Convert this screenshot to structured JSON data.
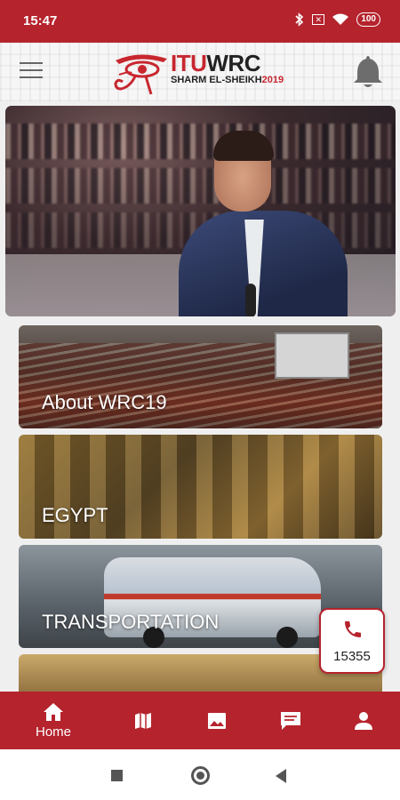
{
  "status_bar": {
    "time": "15:47",
    "battery": "100",
    "icons": [
      "bluetooth-icon",
      "nfc-icon",
      "wifi-icon",
      "battery-icon"
    ]
  },
  "header": {
    "logo": {
      "itu": "ITU",
      "wrc": "WRC",
      "subtitle_left": "SHARM EL-SHEIKH",
      "subtitle_right": "2019"
    },
    "menu_icon": "hamburger-menu-icon",
    "notification_icon": "bell-icon"
  },
  "categories": [
    {
      "label": "About WRC19"
    },
    {
      "label": "EGYPT"
    },
    {
      "label": "TRANSPORTATION"
    }
  ],
  "call_button": {
    "number": "15355",
    "icon": "phone-icon"
  },
  "bottom_nav": [
    {
      "label": "Home",
      "icon": "home-icon",
      "active": true
    },
    {
      "label": "",
      "icon": "map-icon"
    },
    {
      "label": "",
      "icon": "gallery-icon"
    },
    {
      "label": "",
      "icon": "chat-icon"
    },
    {
      "label": "",
      "icon": "profile-icon"
    }
  ],
  "colors": {
    "brand_red": "#b5232d",
    "logo_red": "#c8262f",
    "header_bg": "#f6f6f6"
  }
}
